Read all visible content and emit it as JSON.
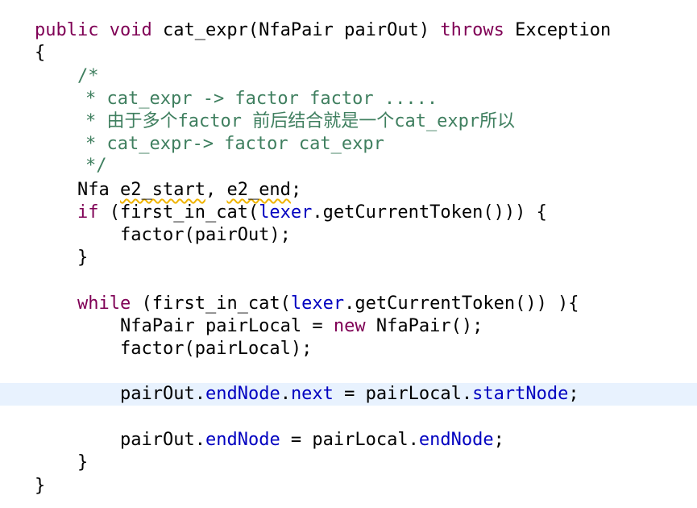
{
  "editor": {
    "highlight_color": "#e8f2fe",
    "colors": {
      "keyword": "#7f0055",
      "comment": "#3f7f5f",
      "field": "#0000c0",
      "warning_underline": "#f0b400"
    },
    "lines": {
      "l1": {
        "public": "public",
        "void": "void",
        "sig": " cat_expr(NfaPair pairOut) ",
        "throws": "throws",
        "rest": " Exception"
      },
      "l2": "{",
      "l3": "/*",
      "l4": "* cat_expr -> factor factor .....",
      "l5": "* 由于多个factor 前后结合就是一个cat_expr所以",
      "l6": "* cat_expr-> factor cat_expr",
      "l7": "*/",
      "l8": {
        "a": "Nfa ",
        "v1": "e2_start",
        "b": ", ",
        "v2": "e2_end",
        "c": ";"
      },
      "l9": {
        "if": "if",
        "a": " (first_in_cat(",
        "lexer": "lexer",
        "b": ".getCurrentToken())) {"
      },
      "l10": "factor(pairOut);",
      "l11": "}",
      "l12": {
        "while": "while",
        "a": " (first_in_cat(",
        "lexer": "lexer",
        "b": ".getCurrentToken()) ){"
      },
      "l13": {
        "a": "NfaPair pairLocal = ",
        "new": "new",
        "b": " NfaPair();"
      },
      "l14": "factor(pairLocal);",
      "l15": {
        "a": "pairOut.",
        "f1": "endNode",
        "b": ".",
        "f2": "next",
        "c": " = pairLocal.",
        "f3": "startNode",
        "d": ";"
      },
      "l16": {
        "a": "pairOut.",
        "f1": "endNode",
        "b": " = pairLocal.",
        "f2": "endNode",
        "c": ";"
      },
      "l17": "}",
      "l18": "}"
    }
  }
}
